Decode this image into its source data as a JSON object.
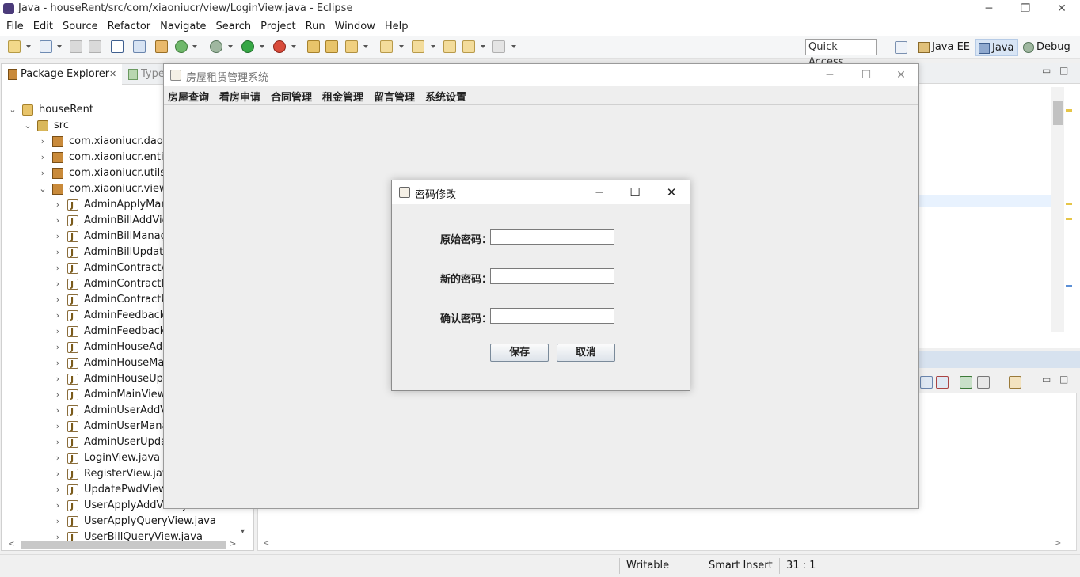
{
  "window": {
    "title": "Java - houseRent/src/com/xiaoniucr/view/LoginView.java - Eclipse",
    "minimize": "─",
    "restore": "❐",
    "close": "✕"
  },
  "menubar": [
    "File",
    "Edit",
    "Source",
    "Refactor",
    "Navigate",
    "Search",
    "Project",
    "Run",
    "Window",
    "Help"
  ],
  "toolbar": {
    "quick_access": "Quick Access",
    "perspectives": [
      {
        "label": "Java EE",
        "active": false
      },
      {
        "label": "Java",
        "active": true
      },
      {
        "label": "Debug",
        "active": false
      }
    ]
  },
  "package_explorer": {
    "tab_label": "Package Explorer",
    "tab_close": "✕",
    "second_tab": "Type",
    "tree": [
      {
        "label": "houseRent",
        "icon": "project-icon",
        "expanded": true
      },
      {
        "label": "src",
        "icon": "source-folder-icon",
        "expanded": true
      },
      {
        "label": "com.xiaoniucr.dao",
        "icon": "package-icon",
        "expanded": false
      },
      {
        "label": "com.xiaoniucr.entity",
        "icon": "package-icon",
        "expanded": false
      },
      {
        "label": "com.xiaoniucr.utils",
        "icon": "package-icon",
        "expanded": false
      },
      {
        "label": "com.xiaoniucr.view",
        "icon": "package-icon",
        "expanded": true
      },
      {
        "label": "AdminApplyMana",
        "icon": "java-file-icon"
      },
      {
        "label": "AdminBillAddView",
        "icon": "java-file-icon"
      },
      {
        "label": "AdminBillManage",
        "icon": "java-file-icon"
      },
      {
        "label": "AdminBillUpdateV",
        "icon": "java-file-icon"
      },
      {
        "label": "AdminContractAd",
        "icon": "java-file-icon"
      },
      {
        "label": "AdminContractMa",
        "icon": "java-file-icon"
      },
      {
        "label": "AdminContractUp",
        "icon": "java-file-icon"
      },
      {
        "label": "AdminFeedbackM",
        "icon": "java-file-icon"
      },
      {
        "label": "AdminFeedbackR",
        "icon": "java-file-icon"
      },
      {
        "label": "AdminHouseAdd\\",
        "icon": "java-file-icon"
      },
      {
        "label": "AdminHouseMan",
        "icon": "java-file-icon"
      },
      {
        "label": "AdminHouseUpd",
        "icon": "java-file-icon"
      },
      {
        "label": "AdminMainView.j",
        "icon": "java-file-icon"
      },
      {
        "label": "AdminUserAddVi",
        "icon": "java-file-icon"
      },
      {
        "label": "AdminUserManag",
        "icon": "java-file-icon"
      },
      {
        "label": "AdminUserUpdat",
        "icon": "java-file-icon"
      },
      {
        "label": "LoginView.java",
        "icon": "java-file-icon"
      },
      {
        "label": "RegisterView.java",
        "icon": "java-file-icon"
      },
      {
        "label": "UpdatePwdView.j",
        "icon": "java-file-icon"
      },
      {
        "label": "UserApplyAddView.java",
        "icon": "java-file-icon"
      },
      {
        "label": "UserApplyQueryView.java",
        "icon": "java-file-icon"
      },
      {
        "label": "UserBillQueryView.java",
        "icon": "java-file-icon"
      }
    ]
  },
  "status": {
    "writable": "Writable",
    "insert_mode": "Smart Insert",
    "position": "31 : 1"
  },
  "app_frame": {
    "title": "房屋租赁管理系统",
    "menus": [
      "房屋查询",
      "看房申请",
      "合同管理",
      "租金管理",
      "留言管理",
      "系统设置"
    ]
  },
  "dialog": {
    "title": "密码修改",
    "fields": [
      {
        "label": "原始密码：",
        "value": ""
      },
      {
        "label": "新的密码：",
        "value": ""
      },
      {
        "label": "确认密码：",
        "value": ""
      }
    ],
    "save_label": "保存",
    "cancel_label": "取消"
  }
}
